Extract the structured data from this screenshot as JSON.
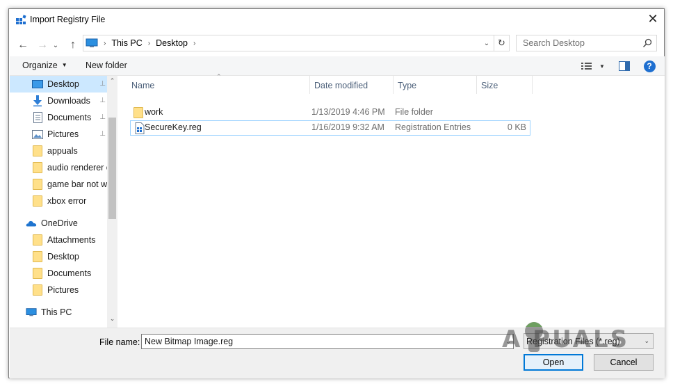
{
  "window": {
    "title": "Import Registry File",
    "close_glyph": "✕",
    "icon": "regedit-icon"
  },
  "navigation": {
    "back_glyph": "←",
    "forward_glyph": "→",
    "recent_glyph": "⌄",
    "up_glyph": "↑"
  },
  "address": {
    "breadcrumbs": [
      "This PC",
      "Desktop"
    ],
    "separator": "›",
    "refresh_glyph": "↻"
  },
  "search": {
    "placeholder": "Search Desktop"
  },
  "toolbar": {
    "organize_label": "Organize",
    "new_folder_label": "New folder",
    "caret_glyph": "▼",
    "help_glyph": "?"
  },
  "nav_pane": {
    "items": [
      {
        "label": "Desktop",
        "icon": "desktop-icon",
        "pinned": true,
        "selected": true
      },
      {
        "label": "Downloads",
        "icon": "download-icon",
        "pinned": true
      },
      {
        "label": "Documents",
        "icon": "documents-icon",
        "pinned": true
      },
      {
        "label": "Pictures",
        "icon": "pictures-icon",
        "pinned": true
      },
      {
        "label": "appuals",
        "icon": "folder-icon"
      },
      {
        "label": "audio renderer e",
        "icon": "folder-icon"
      },
      {
        "label": "game bar not wo",
        "icon": "folder-icon"
      },
      {
        "label": "xbox error",
        "icon": "folder-icon"
      },
      {
        "label": "OneDrive",
        "icon": "onedrive-icon"
      },
      {
        "label": "Attachments",
        "icon": "folder-icon"
      },
      {
        "label": "Desktop",
        "icon": "folder-icon"
      },
      {
        "label": "Documents",
        "icon": "folder-icon"
      },
      {
        "label": "Pictures",
        "icon": "folder-icon"
      },
      {
        "label": "This PC",
        "icon": "this-pc-icon"
      }
    ],
    "pin_glyph": "📌",
    "scroll_up_glyph": "⌃",
    "scroll_down_glyph": "⌄"
  },
  "file_list": {
    "columns": [
      "Name",
      "Date modified",
      "Type",
      "Size"
    ],
    "sort_glyph": "⌃",
    "rows": [
      {
        "name": "work",
        "date": "1/13/2019 4:46 PM",
        "type": "File folder",
        "size": "",
        "icon": "folder-icon"
      },
      {
        "name": "SecureKey.reg",
        "date": "1/16/2019 9:32 AM",
        "type": "Registration Entries",
        "size": "0 KB",
        "icon": "reg-file-icon",
        "selected": true
      }
    ]
  },
  "footer": {
    "file_name_label": "File name:",
    "file_name_value": "New Bitmap Image.reg",
    "file_type_value": "Registration Files (*.reg)",
    "open_label": "Open",
    "cancel_label": "Cancel"
  },
  "watermark": {
    "text": "A  PUALS"
  },
  "colors": {
    "selection": "#cce8ff",
    "accent": "#0078d7",
    "help": "#1e6fd0"
  }
}
